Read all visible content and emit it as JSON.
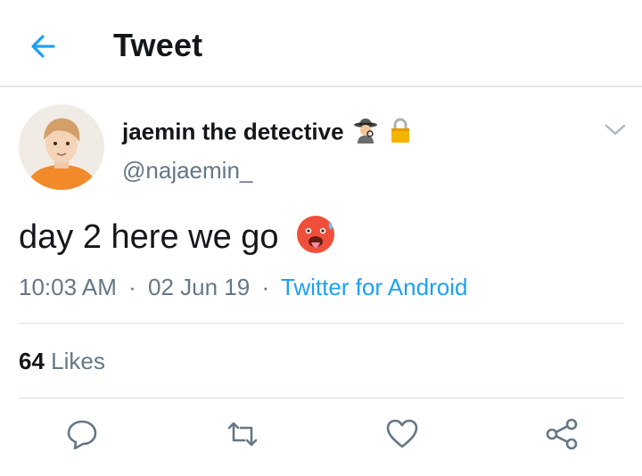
{
  "header": {
    "title": "Tweet",
    "back_icon": "arrow-left-icon"
  },
  "tweet": {
    "author": {
      "display_name": "jaemin the detective",
      "badges": [
        "detective-emoji",
        "lock-icon"
      ],
      "handle": "@najaemin_"
    },
    "text": "day 2 here we go",
    "emoji": "hot-face-emoji",
    "time": "10:03 AM",
    "date": "02 Jun 19",
    "separator": "·",
    "source": "Twitter for Android",
    "likes": {
      "count": "64",
      "label": "Likes"
    }
  },
  "actions": [
    "reply-icon",
    "retweet-icon",
    "like-icon",
    "share-icon"
  ],
  "colors": {
    "accent": "#1da1f2",
    "text": "#14171a",
    "secondary": "#657786",
    "border": "#e1e8ed"
  }
}
